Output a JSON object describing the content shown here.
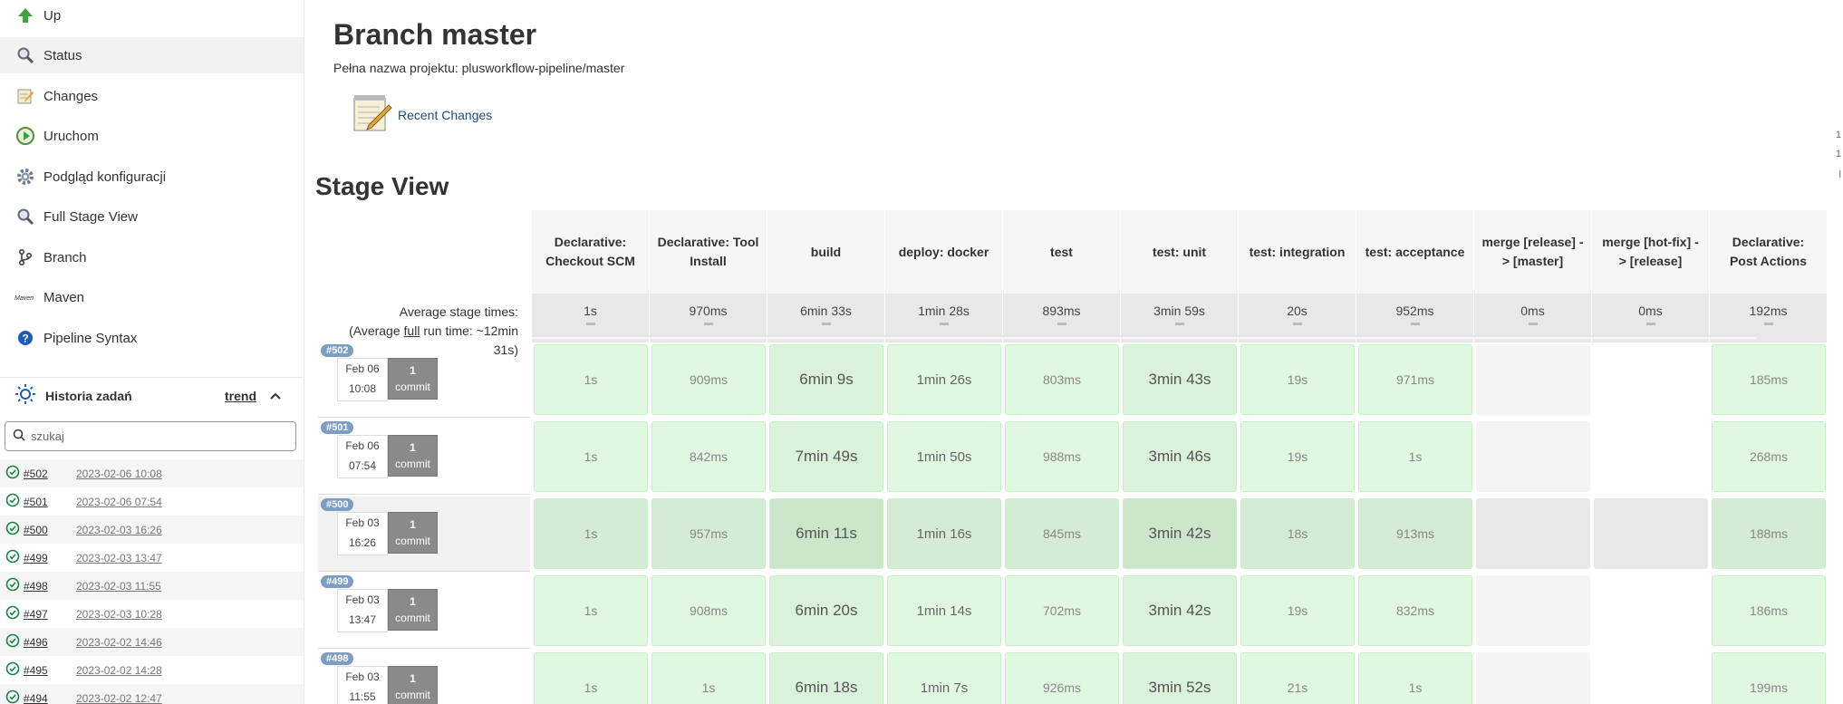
{
  "sidebar": {
    "items": [
      {
        "label": "Up",
        "icon": "up-arrow-icon"
      },
      {
        "label": "Status",
        "icon": "search-icon"
      },
      {
        "label": "Changes",
        "icon": "notepad-icon"
      },
      {
        "label": "Uruchom",
        "icon": "run-clock-icon"
      },
      {
        "label": "Podgląd konfiguracji",
        "icon": "gear-icon"
      },
      {
        "label": "Full Stage View",
        "icon": "search-icon"
      },
      {
        "label": "Branch",
        "icon": "branch-icon"
      },
      {
        "label": "Maven",
        "icon": "maven-icon"
      },
      {
        "label": "Pipeline Syntax",
        "icon": "help-icon"
      }
    ],
    "history": {
      "title": "Historia zadań",
      "trend_label": "trend",
      "search_placeholder": "szukaj",
      "builds": [
        {
          "number": "#502",
          "date": "2023-02-06 10:08"
        },
        {
          "number": "#501",
          "date": "2023-02-06 07:54"
        },
        {
          "number": "#500",
          "date": "2023-02-03 16:26"
        },
        {
          "number": "#499",
          "date": "2023-02-03 13:47"
        },
        {
          "number": "#498",
          "date": "2023-02-03 11:55"
        },
        {
          "number": "#497",
          "date": "2023-02-03 10:28"
        },
        {
          "number": "#496",
          "date": "2023-02-02 14:46"
        },
        {
          "number": "#495",
          "date": "2023-02-02 14:28"
        },
        {
          "number": "#494",
          "date": "2023-02-02 12:47"
        }
      ]
    }
  },
  "main": {
    "title": "Branch master",
    "full_name": "Pełna nazwa projektu: plusworkflow-pipeline/master",
    "recent_changes": "Recent Changes",
    "stage_view_title": "Stage View",
    "edge_marks": [
      "1",
      "1",
      "l"
    ],
    "avg_label_prefix": "Average stage times:",
    "avg_label_open": "(Average ",
    "avg_label_full": "full",
    "avg_label_rest": " run time: ~12min",
    "avg_label_end": "31s)",
    "stages": [
      {
        "name": "Declarative: Checkout SCM",
        "avg": "1s"
      },
      {
        "name": "Declarative: Tool Install",
        "avg": "970ms"
      },
      {
        "name": "build",
        "avg": "6min 33s"
      },
      {
        "name": "deploy: docker",
        "avg": "1min 28s"
      },
      {
        "name": "test",
        "avg": "893ms"
      },
      {
        "name": "test: unit",
        "avg": "3min 59s"
      },
      {
        "name": "test: integration",
        "avg": "20s"
      },
      {
        "name": "test: acceptance",
        "avg": "952ms"
      },
      {
        "name": "merge [release] -> [master]",
        "avg": "0ms"
      },
      {
        "name": "merge [hot-fix] -> [release]",
        "avg": "0ms"
      },
      {
        "name": "Declarative: Post Actions",
        "avg": "192ms"
      }
    ],
    "runs": [
      {
        "badge": "#502",
        "day": "Feb 06",
        "time": "10:08",
        "commits": "1",
        "commit_label": "commit",
        "times": [
          "1s",
          "909ms",
          "6min 9s",
          "1min 26s",
          "803ms",
          "3min 43s",
          "19s",
          "971ms",
          "",
          "",
          "185ms"
        ]
      },
      {
        "badge": "#501",
        "day": "Feb 06",
        "time": "07:54",
        "commits": "1",
        "commit_label": "commit",
        "times": [
          "1s",
          "842ms",
          "7min 49s",
          "1min 50s",
          "988ms",
          "3min 46s",
          "19s",
          "1s",
          "",
          "",
          "268ms"
        ]
      },
      {
        "badge": "#500",
        "day": "Feb 03",
        "time": "16:26",
        "commits": "1",
        "commit_label": "commit",
        "times": [
          "1s",
          "957ms",
          "6min 11s",
          "1min 16s",
          "845ms",
          "3min 42s",
          "18s",
          "913ms",
          "",
          "",
          "188ms"
        ]
      },
      {
        "badge": "#499",
        "day": "Feb 03",
        "time": "13:47",
        "commits": "1",
        "commit_label": "commit",
        "times": [
          "1s",
          "908ms",
          "6min 20s",
          "1min 14s",
          "702ms",
          "3min 42s",
          "19s",
          "832ms",
          "",
          "",
          "186ms"
        ]
      },
      {
        "badge": "#498",
        "day": "Feb 03",
        "time": "11:55",
        "commits": "1",
        "commit_label": "commit",
        "times": [
          "1s",
          "1s",
          "6min 18s",
          "1min 7s",
          "926ms",
          "3min 52s",
          "21s",
          "1s",
          "",
          "",
          "199ms"
        ]
      }
    ]
  }
}
